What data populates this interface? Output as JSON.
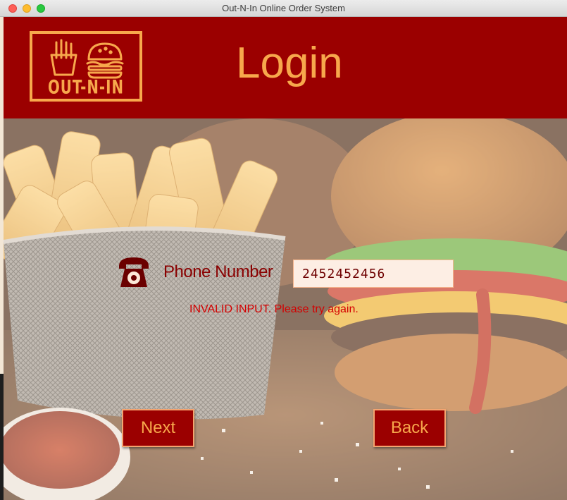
{
  "window": {
    "title": "Out-N-In Online Order System"
  },
  "header": {
    "logo_text": "OUT-N-IN",
    "title": "Login"
  },
  "form": {
    "phone_label": "Phone Number",
    "phone_value": "2452452456",
    "error_message": "INVALID INPUT. Please try again."
  },
  "buttons": {
    "next_label": "Next",
    "back_label": "Back"
  },
  "icons": {
    "phone": "telephone-icon",
    "fries": "fries-icon",
    "burger": "burger-icon"
  },
  "colors": {
    "header_bg": "#9b0000",
    "accent_orange": "#f7a84c",
    "error_red": "#d40000",
    "label_red": "#8a0000"
  }
}
